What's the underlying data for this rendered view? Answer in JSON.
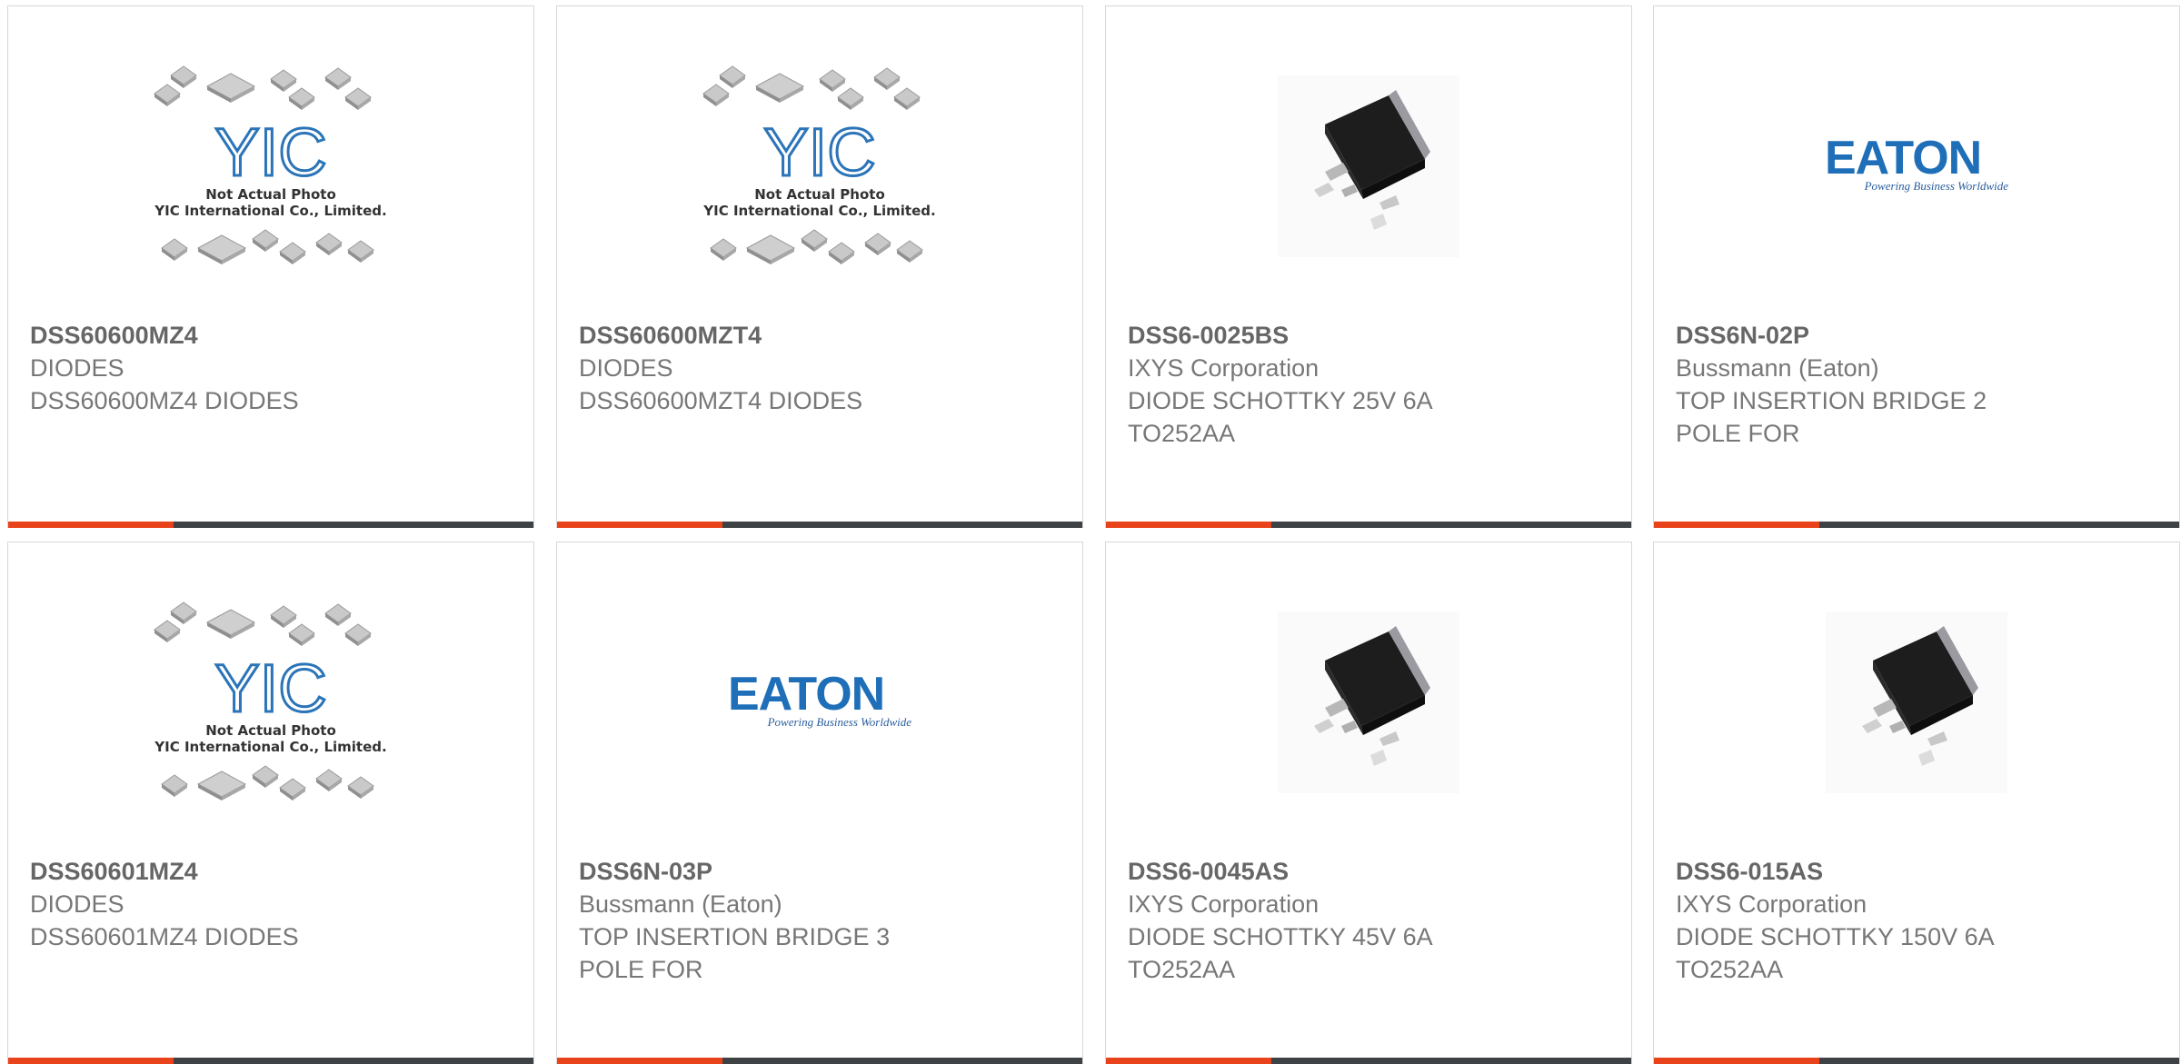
{
  "accent_color": "#e8431a",
  "bar_color": "#3f4245",
  "products": [
    {
      "part_number": "DSS60600MZ4",
      "manufacturer": "DIODES",
      "desc_line1": "DSS60600MZ4 DIODES",
      "desc_line2": "",
      "image": "yic-placeholder",
      "image_caption1": "Not Actual Photo",
      "image_caption2": "YIC International Co., Limited.",
      "image_logo": "YIC"
    },
    {
      "part_number": "DSS60600MZT4",
      "manufacturer": "DIODES",
      "desc_line1": "DSS60600MZT4 DIODES",
      "desc_line2": "",
      "image": "yic-placeholder",
      "image_caption1": "Not Actual Photo",
      "image_caption2": "YIC International Co., Limited.",
      "image_logo": "YIC"
    },
    {
      "part_number": "DSS6-0025BS",
      "manufacturer": "IXYS Corporation",
      "desc_line1": "DIODE SCHOTTKY 25V 6A",
      "desc_line2": "TO252AA",
      "image": "to252-package"
    },
    {
      "part_number": "DSS6N-02P",
      "manufacturer": "Bussmann (Eaton)",
      "desc_line1": "TOP INSERTION BRIDGE 2",
      "desc_line2": "POLE FOR",
      "image": "eaton-logo",
      "image_logo": "EATON",
      "image_tagline": "Powering Business Worldwide"
    },
    {
      "part_number": "DSS60601MZ4",
      "manufacturer": "DIODES",
      "desc_line1": "DSS60601MZ4 DIODES",
      "desc_line2": "",
      "image": "yic-placeholder",
      "image_caption1": "Not Actual Photo",
      "image_caption2": "YIC International Co., Limited.",
      "image_logo": "YIC"
    },
    {
      "part_number": "DSS6N-03P",
      "manufacturer": "Bussmann (Eaton)",
      "desc_line1": "TOP INSERTION BRIDGE 3",
      "desc_line2": "POLE FOR",
      "image": "eaton-logo",
      "image_logo": "EATON",
      "image_tagline": "Powering Business Worldwide"
    },
    {
      "part_number": "DSS6-0045AS",
      "manufacturer": "IXYS Corporation",
      "desc_line1": "DIODE SCHOTTKY 45V 6A",
      "desc_line2": "TO252AA",
      "image": "to252-package"
    },
    {
      "part_number": "DSS6-015AS",
      "manufacturer": "IXYS Corporation",
      "desc_line1": "DIODE SCHOTTKY 150V 6A",
      "desc_line2": "TO252AA",
      "image": "to252-package"
    }
  ]
}
